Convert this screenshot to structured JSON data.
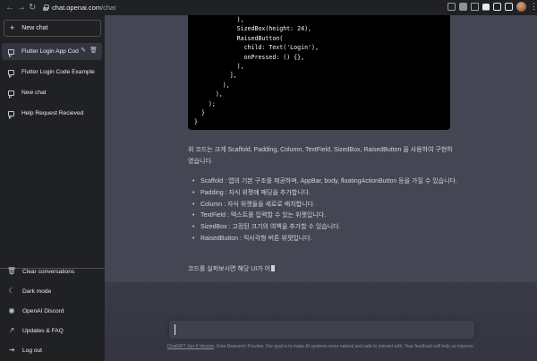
{
  "browser": {
    "url_host": "chat.openai.com",
    "url_path": "/chat",
    "icons": [
      "back-icon",
      "forward-icon",
      "reload-icon",
      "lock-icon"
    ]
  },
  "sidebar": {
    "new_chat_label": "New chat",
    "items": [
      {
        "label": "Flutter Login App Cod",
        "active": true
      },
      {
        "label": "Flutter Login Code Example",
        "active": false
      },
      {
        "label": "New chat",
        "active": false
      },
      {
        "label": "Help Request Recieved",
        "active": false
      }
    ],
    "bottom": [
      {
        "label": "Clear conversations",
        "icon": "trash-icon"
      },
      {
        "label": "Dark mode",
        "icon": "moon-icon"
      },
      {
        "label": "OpenAI Discord",
        "icon": "discord-icon"
      },
      {
        "label": "Updates & FAQ",
        "icon": "external-link-icon"
      },
      {
        "label": "Log out",
        "icon": "logout-icon"
      }
    ]
  },
  "conversation": {
    "code": "            ),\n            SizedBox(height: 24),\n            RaisedButton(\n              child: Text('Login'),\n              onPressed: () {},\n            ),\n          ],\n        ),\n      ),\n    );\n  }\n}",
    "intro": "위 코드는 크게 Scaffold, Padding, Column, TextField, SizedBox, RaisedButton 을 사용하여 구현하였습니다.",
    "bullets": [
      "Scaffold : 앱의 기본 구조를 제공하며, AppBar, body, floatingActionButton 등을 가질 수 있습니다.",
      "Padding : 자식 위젯에 패딩을 추가합니다.",
      "Column : 자식 위젯들을 세로로 배치합니다.",
      "TextField : 텍스트를 입력할 수 있는 위젯입니다.",
      "SizedBox : 고정된 크기의 여백을 추가할 수 있습니다.",
      "RaisedButton : 직사각형 버튼 위젯입니다."
    ],
    "partial": "코드를 실퍼보시면 해당 UI가 어"
  },
  "input": {
    "value": "",
    "placeholder": ""
  },
  "footer": {
    "link_text": "ChatGPT Jan 9 Version",
    "note": ". Free Research Preview. Our goal is to make AI systems more natural and safe to interact with. Your feedback will help us improve."
  }
}
